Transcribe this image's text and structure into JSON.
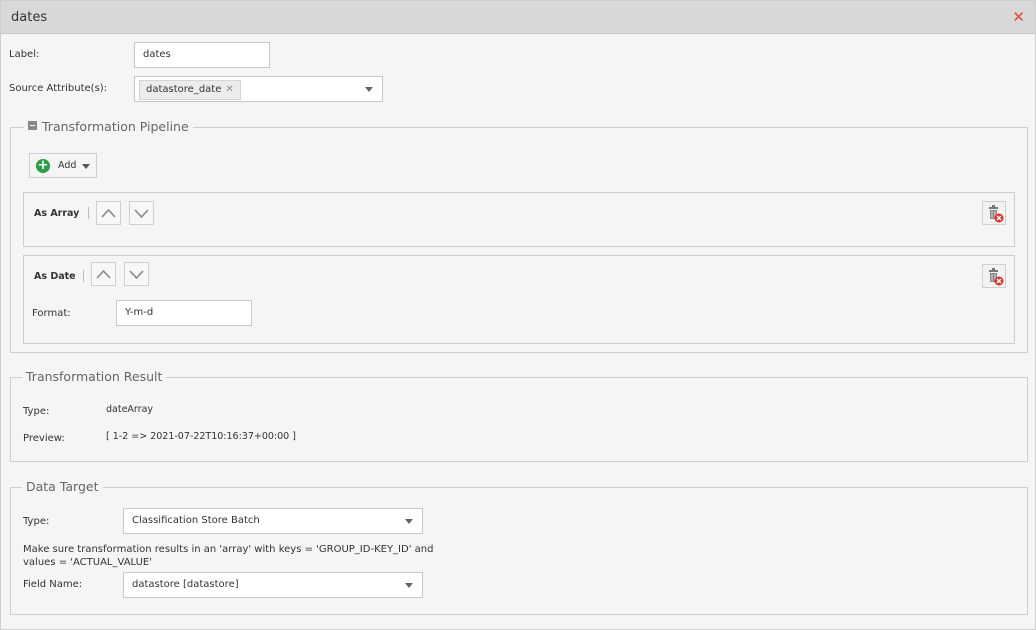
{
  "window": {
    "title": "dates"
  },
  "form": {
    "label_label": "Label:",
    "label_value": "dates",
    "source_label": "Source Attribute(s):",
    "source_tag": "datastore_date"
  },
  "pipeline": {
    "legend": "Transformation Pipeline",
    "add_label": "Add",
    "steps": [
      {
        "title": "As Array"
      },
      {
        "title": "As Date",
        "format_label": "Format:",
        "format_value": "Y-m-d"
      }
    ]
  },
  "result": {
    "legend": "Transformation Result",
    "type_label": "Type:",
    "type_value": "dateArray",
    "preview_label": "Preview:",
    "preview_value": "[ 1-2 => 2021-07-22T10:16:37+00:00 ]"
  },
  "target": {
    "legend": "Data Target",
    "type_label": "Type:",
    "type_value": "Classification Store Batch",
    "note_line1": "Make sure transformation results in an 'array' with keys = 'GROUP_ID-KEY_ID' and",
    "note_line2": "values = 'ACTUAL_VALUE'",
    "field_label": "Field Name:",
    "field_value": "datastore [datastore]"
  },
  "colors": {
    "add_green": "#2e9b4a",
    "close_red": "#e04a2a"
  }
}
